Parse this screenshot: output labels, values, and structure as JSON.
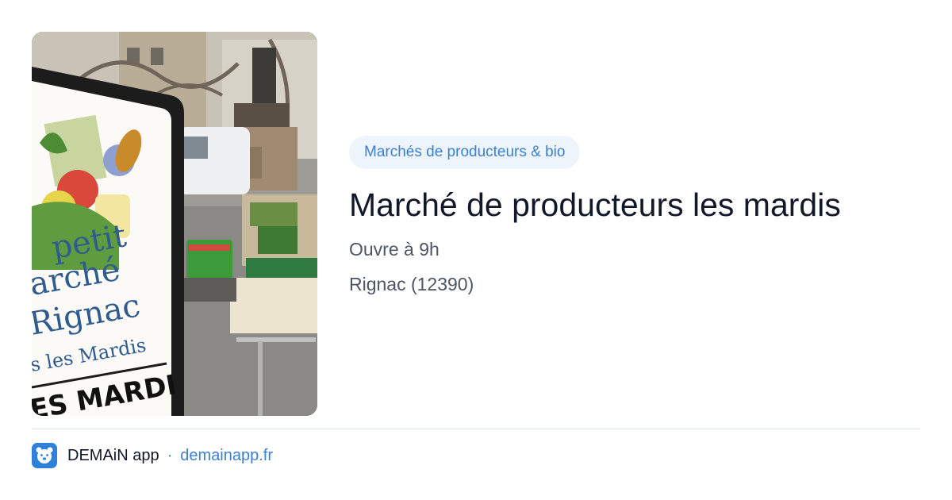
{
  "card": {
    "category": "Marchés de producteurs & bio",
    "title": "Marché de producteurs les mardis",
    "opening": "Ouvre à 9h",
    "location": "Rignac (12390)"
  },
  "photo": {
    "sign_lines": [
      "petit",
      "arché",
      "Rignac",
      "s les Mardis",
      "ES MARDI"
    ]
  },
  "footer": {
    "app_name": "DEMAiN app",
    "separator": "·",
    "link": "demainapp.fr"
  },
  "colors": {
    "accent": "#3b7fd1",
    "category_bg": "#eef4fc",
    "logo_bg": "#2f80d8"
  },
  "icons": {
    "app_logo": "bear-face-icon"
  }
}
